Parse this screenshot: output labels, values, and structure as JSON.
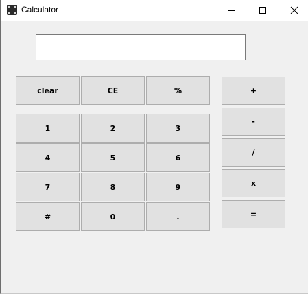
{
  "window": {
    "title": "Calculator",
    "controls": {
      "minimize": "minimize",
      "maximize": "maximize",
      "close": "close"
    }
  },
  "display": {
    "value": "",
    "placeholder": ""
  },
  "keypad": {
    "row0": [
      "clear",
      "CE",
      "%"
    ],
    "row1": [
      "1",
      "2",
      "3"
    ],
    "row2": [
      "4",
      "5",
      "6"
    ],
    "row3": [
      "7",
      "8",
      "9"
    ],
    "row4": [
      "#",
      "0",
      "."
    ]
  },
  "operators": [
    "+",
    "-",
    "/",
    "x",
    "="
  ],
  "colors": {
    "background": "#f0f0f0",
    "button_face": "#e1e1e1",
    "button_border": "#adadad",
    "titlebar": "#ffffff"
  }
}
